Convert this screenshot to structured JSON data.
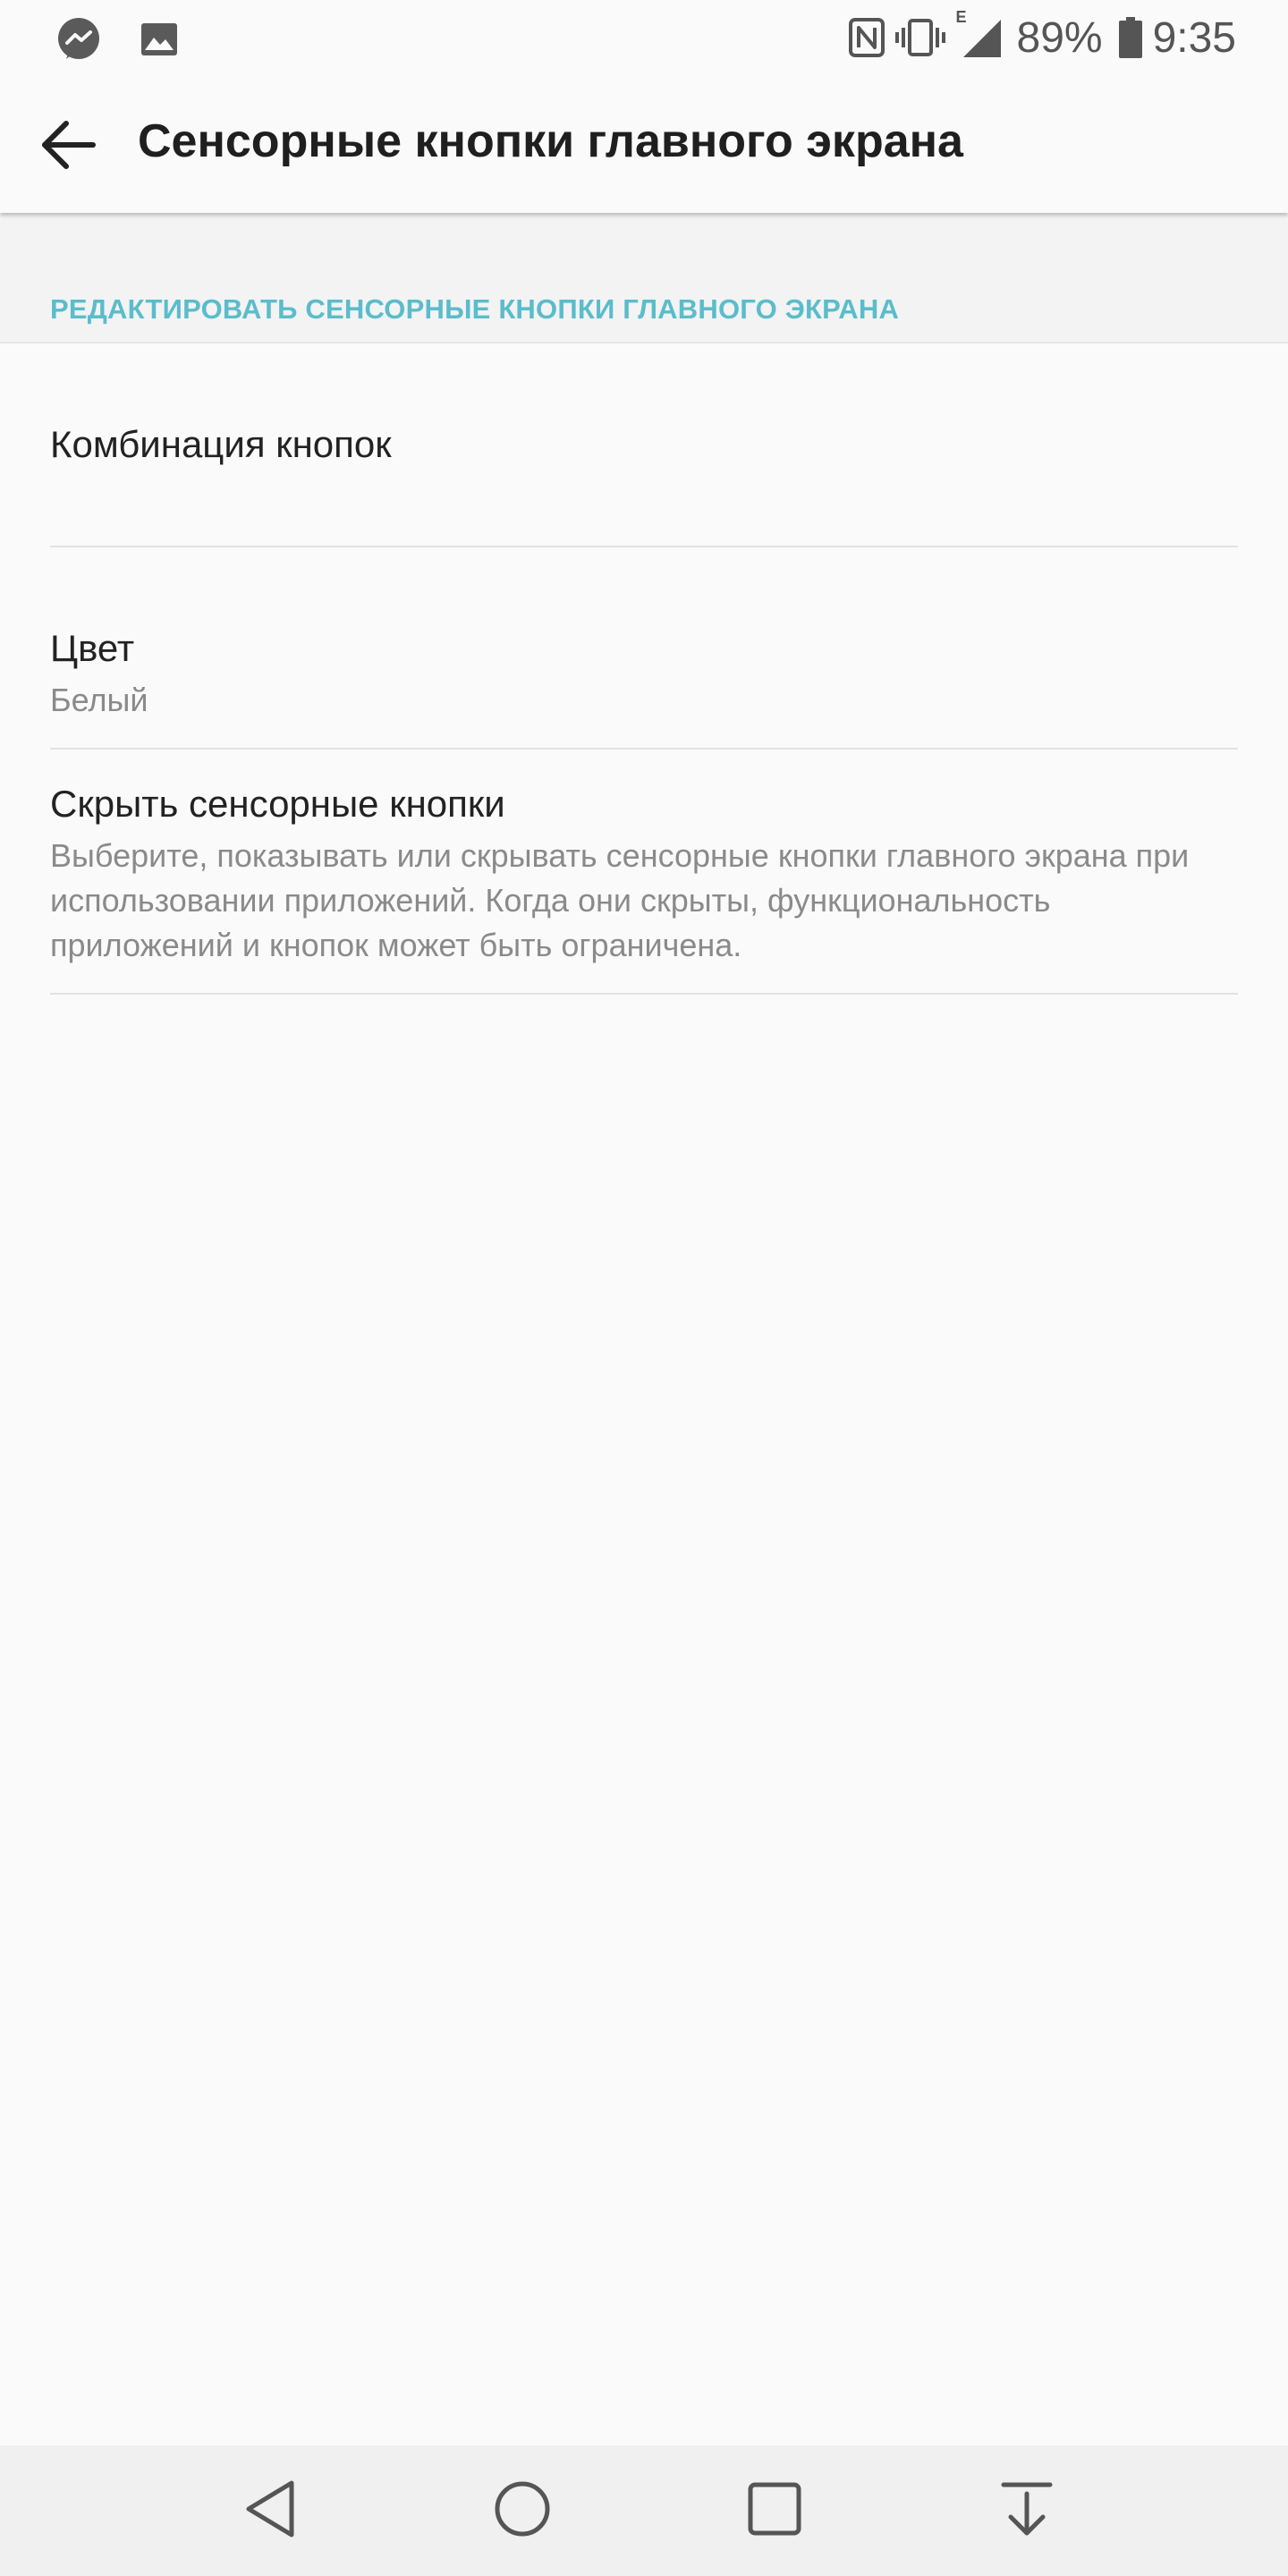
{
  "status_bar": {
    "left_icons": [
      "messenger-icon",
      "gallery-icon"
    ],
    "right_icons": [
      "nfc-icon",
      "vibrate-icon",
      "signal-icon",
      "battery-icon"
    ],
    "network_type": "E",
    "battery_percent": "89%",
    "time": "9:35"
  },
  "app_bar": {
    "back_icon": "arrow-back-icon",
    "title": "Сенсорные кнопки главного экрана"
  },
  "section": {
    "header": "РЕДАКТИРОВАТЬ СЕНСОРНЫЕ КНОПКИ ГЛАВНОГО ЭКРАНА"
  },
  "items": [
    {
      "title": "Комбинация кнопок"
    },
    {
      "title": "Цвет",
      "summary": "Белый"
    },
    {
      "title": "Скрыть сенсорные кнопки",
      "summary": "Выберите, показывать или скрывать сенсорные кнопки главного экрана при использовании приложений. Когда они скрыты, функциональность приложений и кнопок может быть ограничена."
    }
  ],
  "nav_bar": {
    "icons": [
      "nav-back-icon",
      "nav-home-icon",
      "nav-recents-icon",
      "nav-notifications-icon"
    ]
  },
  "colors": {
    "accent": "#5bbccb",
    "background": "#fafafa",
    "section_bg": "#f3f3f3",
    "nav_bg": "#f0f0f0",
    "text_primary": "#222222",
    "text_secondary": "#8a8a8a"
  }
}
